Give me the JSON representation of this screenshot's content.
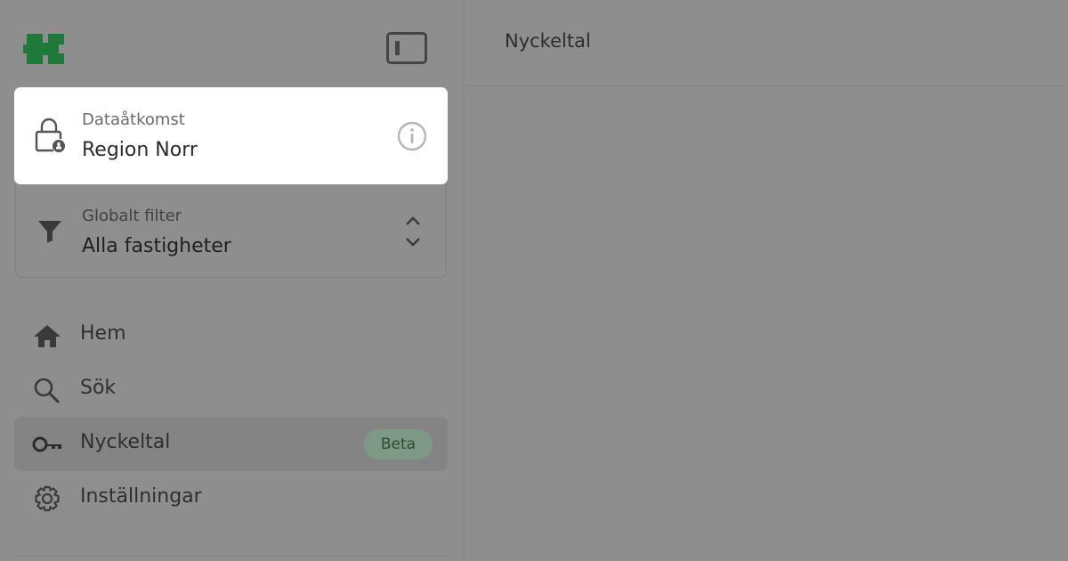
{
  "main": {
    "page_title": "Nyckeltal"
  },
  "sidebar": {
    "logo_icon": "logo-icon",
    "toggle_icon": "sidebar-toggle-icon",
    "data_access": {
      "label": "Dataåtkomst",
      "value": "Region Norr",
      "icon": "lock-icon",
      "info_icon": "info-icon"
    },
    "global_filter": {
      "label": "Globalt filter",
      "value": "Alla fastigheter",
      "icon": "filter-icon",
      "chevron_icon": "chevron-updown-icon"
    },
    "nav": [
      {
        "label": "Hem",
        "icon": "home-icon",
        "active": false
      },
      {
        "label": "Sök",
        "icon": "search-icon",
        "active": false
      },
      {
        "label": "Nyckeltal",
        "icon": "key-icon",
        "active": true,
        "badge": "Beta"
      },
      {
        "label": "Inställningar",
        "icon": "gear-icon",
        "active": false
      }
    ]
  },
  "colors": {
    "brand": "#1f7a3a",
    "badge_bg": "#7e9a87",
    "overlay": "#8e8e8e"
  }
}
